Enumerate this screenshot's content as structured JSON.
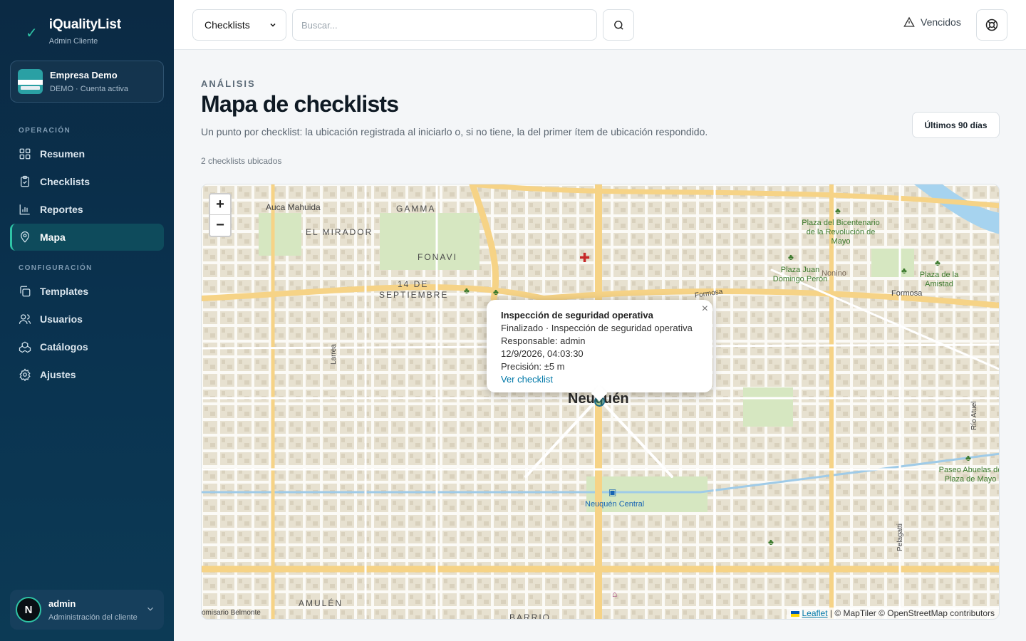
{
  "app": {
    "brand_title": "iQualityList",
    "brand_subtitle": "Admin Cliente"
  },
  "company": {
    "name": "Empresa Demo",
    "meta": "DEMO · Cuenta activa"
  },
  "sidebar": {
    "section_operation": "OPERACIÓN",
    "section_config": "CONFIGURACIÓN",
    "items": [
      {
        "label": "Resumen",
        "icon": "grid-icon"
      },
      {
        "label": "Checklists",
        "icon": "clipboard-icon"
      },
      {
        "label": "Reportes",
        "icon": "bar-chart-icon"
      },
      {
        "label": "Mapa",
        "icon": "map-pin-icon",
        "active": true
      },
      {
        "label": "Templates",
        "icon": "copy-icon"
      },
      {
        "label": "Usuarios",
        "icon": "users-icon"
      },
      {
        "label": "Catálogos",
        "icon": "boxes-icon"
      },
      {
        "label": "Ajustes",
        "icon": "gear-icon"
      }
    ]
  },
  "user": {
    "initial": "N",
    "name": "admin",
    "role": "Administración del cliente"
  },
  "topbar": {
    "select_value": "Checklists",
    "search_placeholder": "Buscar...",
    "overdue_label": "Vencidos"
  },
  "page": {
    "eyebrow": "ANÁLISIS",
    "title": "Mapa de checklists",
    "description": "Un punto por checklist: la ubicación registrada al iniciarlo o, si no tiene, la del primer ítem de ubicación respondido.",
    "range_button": "Últimos 90 días",
    "count": "2 checklists ubicados"
  },
  "map": {
    "zoom_in": "+",
    "zoom_out": "−",
    "popup": {
      "title": "Inspección de seguridad operativa",
      "status": "Finalizado · Inspección de seguridad operativa",
      "responsible": "Responsable: admin",
      "datetime": "12/9/2026, 04:03:30",
      "precision": "Precisión: ±5 m",
      "link": "Ver checklist",
      "close": "×"
    },
    "attribution": {
      "leaflet": "Leaflet",
      "rest": "| © MapTiler © OpenStreetMap contributors"
    },
    "labels": {
      "auca": "Auca Mahuida",
      "gamma": "GAMMA",
      "mirador": "EL MIRADOR",
      "fonavi": "FONAVI",
      "sept14a": "14 DE",
      "sept14b": "SEPTIEMBRE",
      "city": "Neuquén",
      "plaza_bic": "Plaza del Bicentenario de la Revolución de Mayo",
      "plaza_juan": "Plaza Juan Domingo Perón",
      "nonino": "Nonino",
      "plaza_amistad": "Plaza de la Amistad",
      "formosa1": "Formosa",
      "formosa2": "Formosa",
      "larrea": "Larrea",
      "rio_atuel": "Río Atuel",
      "paseo": "Paseo Abuelas de Plaza de Mayo",
      "station": "Neuquén Central",
      "pelagatti": "Pelagatti",
      "amulen": "AMULÉN",
      "barrio": "BARRIO",
      "comisario": "omisario Belmonte"
    }
  },
  "colors": {
    "sidebar": "#0b2a44",
    "accent": "#2fc4a6",
    "active_item": "#0e4b5c",
    "road_major": "#f7d58a",
    "park": "#cfe3b8",
    "water": "#a6d3ef"
  }
}
